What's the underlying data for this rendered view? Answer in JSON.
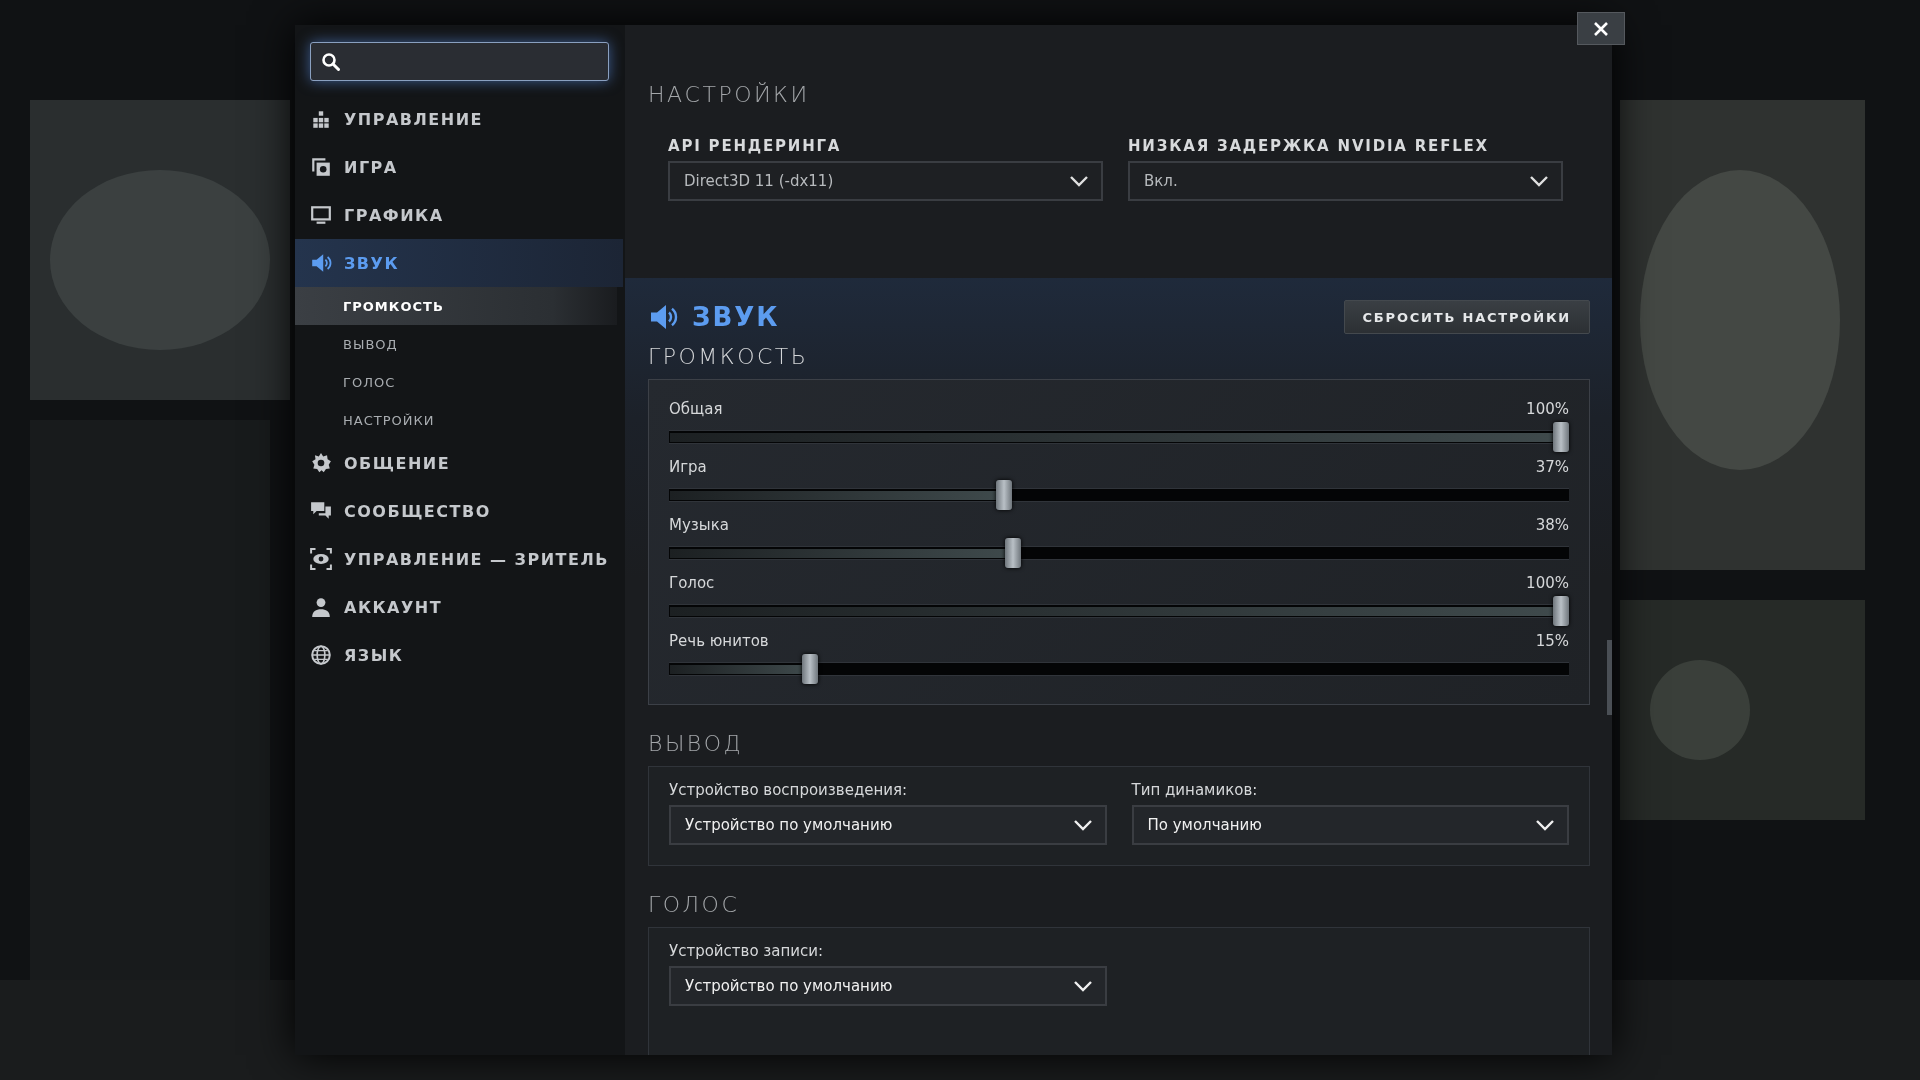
{
  "sidebar": {
    "items": [
      {
        "label": "УПРАВЛЕНИЕ",
        "selected": false
      },
      {
        "label": "ИГРА",
        "selected": false
      },
      {
        "label": "ГРАФИКА",
        "selected": false
      },
      {
        "label": "ЗВУК",
        "selected": true,
        "children": [
          {
            "label": "ГРОМКОСТЬ",
            "selected": true
          },
          {
            "label": "ВЫВОД",
            "selected": false
          },
          {
            "label": "ГОЛОС",
            "selected": false
          },
          {
            "label": "НАСТРОЙКИ",
            "selected": false
          }
        ]
      },
      {
        "label": "ОБЩЕНИЕ",
        "selected": false
      },
      {
        "label": "СООБЩЕСТВО",
        "selected": false
      },
      {
        "label": "УПРАВЛЕНИЕ — ЗРИТЕЛЬ",
        "selected": false
      },
      {
        "label": "АККАУНТ",
        "selected": false
      },
      {
        "label": "ЯЗЫК",
        "selected": false
      }
    ]
  },
  "graphics": {
    "heading": "НАСТРОЙКИ",
    "fields": [
      {
        "label": "API РЕНДЕРИНГА",
        "value": "Direct3D 11 (-dx11)"
      },
      {
        "label": "НИЗКАЯ ЗАДЕРЖКА NVIDIA REFLEX",
        "value": "Вкл."
      }
    ]
  },
  "sound": {
    "title": "ЗВУК",
    "reset_button": "СБРОСИТЬ НАСТРОЙКИ",
    "volume": {
      "heading": "ГРОМКОСТЬ",
      "sliders": [
        {
          "name": "Общая",
          "reading": "100%",
          "level": 1
        },
        {
          "name": "Игра",
          "reading": "37%",
          "level": 0.37
        },
        {
          "name": "Музыка",
          "reading": "38%",
          "level": 0.38
        },
        {
          "name": "Голос",
          "reading": "100%",
          "level": 1
        },
        {
          "name": "Речь юнитов",
          "reading": "15%",
          "level": 0.15
        }
      ]
    },
    "output": {
      "heading": "ВЫВОД",
      "fields": [
        {
          "label": "Устройство воспроизведения:",
          "value": "Устройство по умолчанию"
        },
        {
          "label": "Тип динамиков:",
          "value": "По умолчанию"
        }
      ]
    },
    "voice": {
      "heading": "ГОЛОС",
      "fields": [
        {
          "label": "Устройство записи:",
          "value": "Устройство по умолчанию"
        }
      ]
    }
  }
}
